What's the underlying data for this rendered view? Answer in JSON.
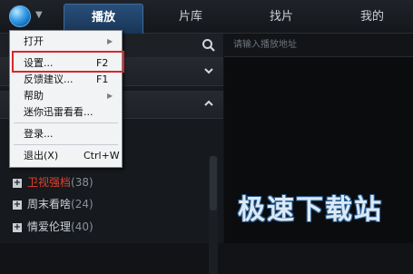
{
  "tabs": [
    {
      "label": "播放",
      "active": true
    },
    {
      "label": "片库",
      "active": false
    },
    {
      "label": "找片",
      "active": false
    },
    {
      "label": "我的",
      "active": false
    }
  ],
  "url_input": {
    "placeholder": "请输入播放地址"
  },
  "menu": {
    "items": [
      {
        "label": "打开",
        "shortcut": "",
        "submenu": true
      },
      {
        "label": "设置...",
        "shortcut": "F2",
        "submenu": false,
        "highlighted": true
      },
      {
        "label": "反馈建议...",
        "shortcut": "F1",
        "submenu": false
      },
      {
        "label": "帮助",
        "shortcut": "",
        "submenu": true
      },
      {
        "label": "迷你迅雷看看...",
        "shortcut": "",
        "submenu": false
      },
      {
        "label": "登录...",
        "shortcut": "",
        "submenu": false
      },
      {
        "label": "退出(X)",
        "shortcut": "Ctrl+W",
        "submenu": false
      }
    ]
  },
  "list": {
    "items": [
      {
        "label": "卫视强档",
        "count": "(38)"
      },
      {
        "label": "周末看啥",
        "count": "(24)"
      },
      {
        "label": "情爱伦理",
        "count": "(40)"
      }
    ]
  },
  "watermark": {
    "text": "极速下载站"
  },
  "colors": {
    "accent": "#2a4f7a",
    "highlight_box": "#d8262a",
    "red_text": "#e0402f"
  }
}
